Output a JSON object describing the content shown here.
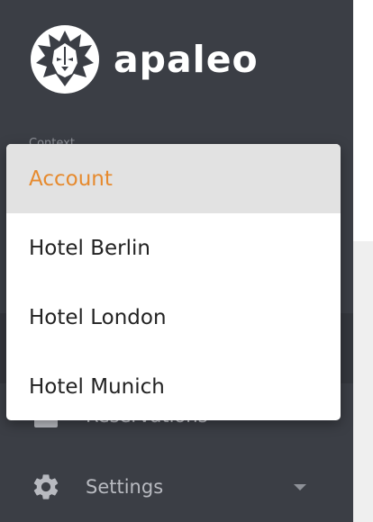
{
  "brand": {
    "name": "apaleo",
    "logo_icon": "lion-head-icon"
  },
  "sidebar": {
    "context_label": "Context",
    "nav": [
      {
        "label": "Reservations",
        "icon": "reservations-icon"
      },
      {
        "label": "Settings",
        "icon": "gear-icon",
        "expand_icon": "chevron-down-icon"
      }
    ]
  },
  "dropdown": {
    "selected_index": 0,
    "options": [
      {
        "label": "Account"
      },
      {
        "label": "Hotel Berlin"
      },
      {
        "label": "Hotel London"
      },
      {
        "label": "Hotel Munich"
      }
    ]
  },
  "colors": {
    "sidebar_bg": "#3b3e45",
    "accent": "#e68a2e",
    "selected_bg": "#e2e2e2",
    "nav_text": "#b8bac0"
  }
}
